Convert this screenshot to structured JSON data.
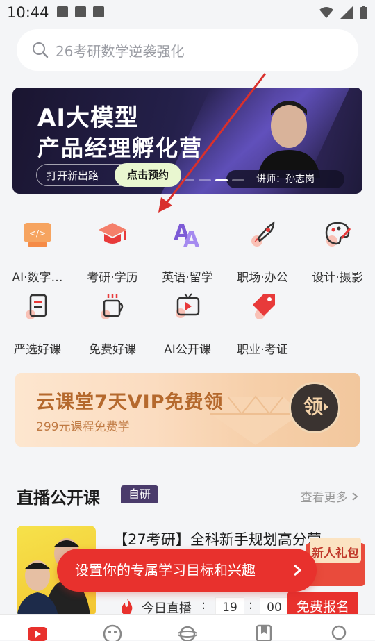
{
  "status": {
    "time": "10:44"
  },
  "search": {
    "placeholder": "26考研数学逆袭强化"
  },
  "banner": {
    "title1": "AI大模型",
    "title2": "产品经理孵化营",
    "pill_left": "打开新出路",
    "pill_btn": "点击预约",
    "lecturer": "讲师：孙志岗"
  },
  "categories": [
    {
      "label": "AI·数字…",
      "icon": "ai-code-icon"
    },
    {
      "label": "考研·学历",
      "icon": "graduation-cap-icon"
    },
    {
      "label": "英语·留学",
      "icon": "language-icon"
    },
    {
      "label": "职场·办公",
      "icon": "rocket-icon"
    },
    {
      "label": "设计·摄影",
      "icon": "palette-icon"
    },
    {
      "label": "严选好课",
      "icon": "document-icon"
    },
    {
      "label": "免费好课",
      "icon": "coffee-icon"
    },
    {
      "label": "AI公开课",
      "icon": "tv-play-icon"
    },
    {
      "label": "职业·考证",
      "icon": "tag-icon"
    }
  ],
  "vip": {
    "title": "云课堂7天VIP免费领",
    "subtitle": "299元课程免费学",
    "btn": "领"
  },
  "live_section": {
    "title": "直播公开课",
    "tag": "自研",
    "more": "查看更多"
  },
  "course": {
    "title": "【27考研】全科新手规划高分营",
    "live_label": "今日直播",
    "hour": "19",
    "minute": "00",
    "register": "免费报名",
    "gift": "新人礼包"
  },
  "toast": {
    "text": "设置你的专属学习目标和兴趣"
  },
  "colors": {
    "accent": "#e8312d",
    "vip_text": "#b5692d",
    "tag_bg": "#4a3b6b"
  }
}
